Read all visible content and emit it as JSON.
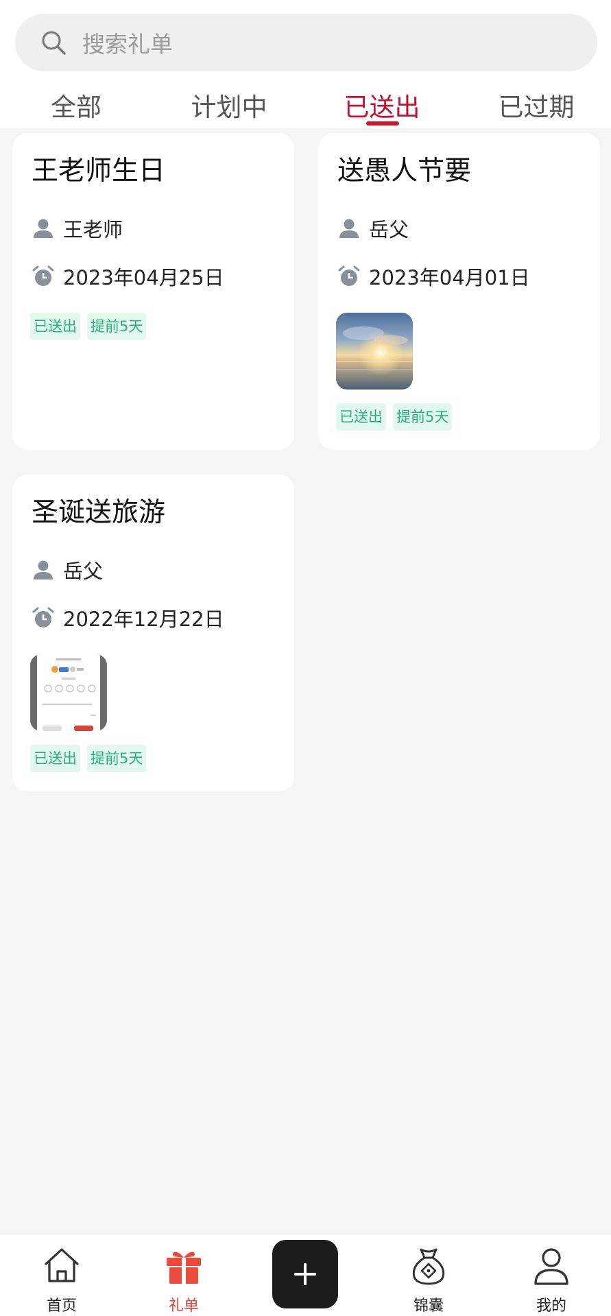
{
  "search": {
    "placeholder": "搜索礼单"
  },
  "tabs": [
    {
      "label": "全部"
    },
    {
      "label": "计划中"
    },
    {
      "label": "已送出"
    },
    {
      "label": "已过期"
    }
  ],
  "active_tab": "已送出",
  "cards": [
    {
      "title": "王老师生日",
      "recipient": "王老师",
      "date": "2023年04月25日",
      "tags": [
        "已送出",
        "提前5天"
      ],
      "has_image": false
    },
    {
      "title": "送愚人节要",
      "recipient": "岳父",
      "date": "2023年04月01日",
      "tags": [
        "已送出",
        "提前5天"
      ],
      "has_image": true,
      "image": "sunset-over-water"
    },
    {
      "title": "圣诞送旅游",
      "recipient": "岳父",
      "date": "2022年12月22日",
      "tags": [
        "已送出",
        "提前5天"
      ],
      "has_image": true,
      "image": "app-screenshot-rating"
    }
  ],
  "bottom_nav": [
    {
      "label": "首页",
      "icon": "home-icon"
    },
    {
      "label": "礼单",
      "icon": "gift-icon"
    },
    {
      "label": "",
      "icon": "plus-icon"
    },
    {
      "label": "锦囊",
      "icon": "money-bag-icon"
    },
    {
      "label": "我的",
      "icon": "user-icon"
    }
  ],
  "colors": {
    "accent": "#c8102e",
    "tag_bg": "#e2f8ef",
    "tag_text": "#27b27a",
    "nav_active": "#e5412f"
  }
}
